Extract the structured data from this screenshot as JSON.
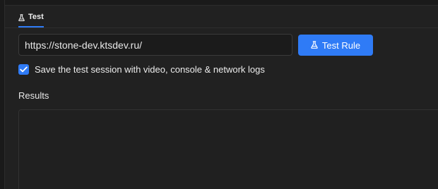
{
  "tabs": [
    {
      "label": "Test",
      "active": true,
      "icon": "flask-icon"
    }
  ],
  "test_form": {
    "url_value": "https://stone-dev.ktsdev.ru/",
    "run_button_label": "Test Rule",
    "run_button_icon": "flask-icon",
    "save_session_checked": true,
    "save_session_label": "Save the test session with video, console & network logs"
  },
  "results": {
    "title": "Results"
  },
  "colors": {
    "accent": "#2f7bf6",
    "background": "#212121"
  }
}
